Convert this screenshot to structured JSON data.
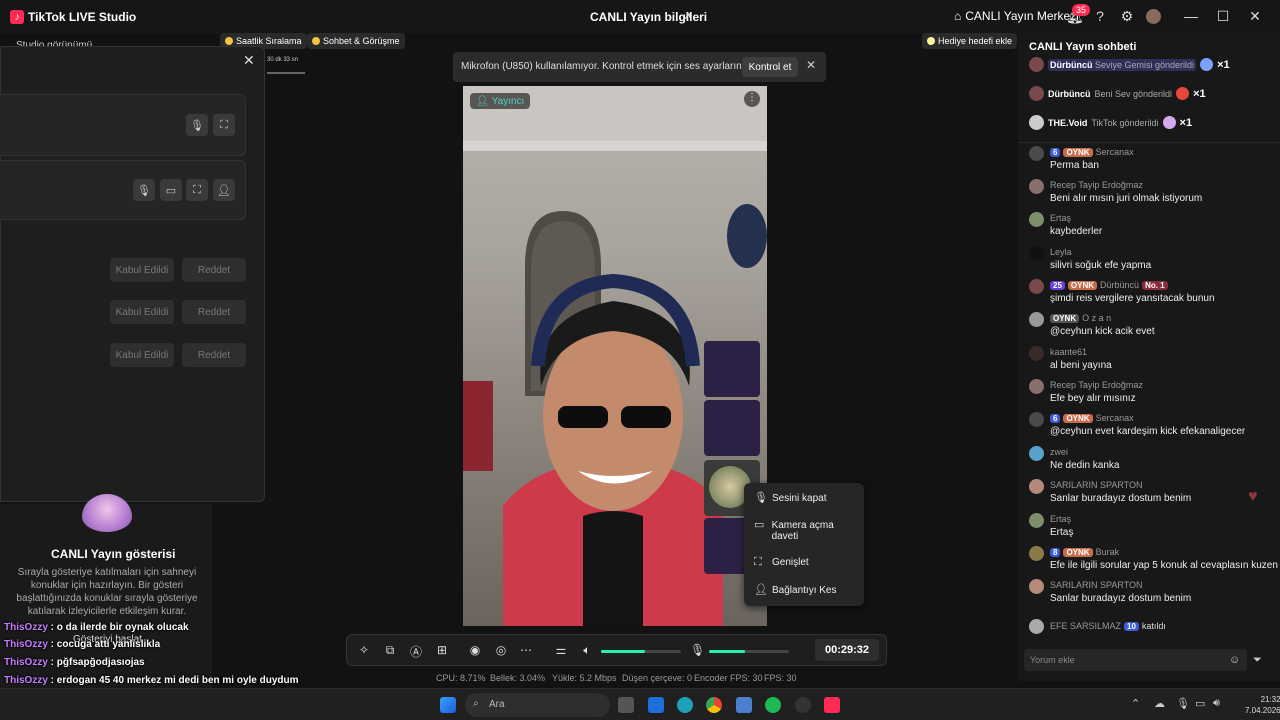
{
  "titlebar": {
    "app_title": "TikTok LIVE Studio",
    "center_title": "CANLI Yayın bilgileri",
    "hub_label": "CANLI Yayın Merkezi",
    "notif_count": "35"
  },
  "pills": {
    "weekly": "Saatlik Sıralama",
    "chat_talk": "Sohbet & Görüşme",
    "gift_goal": "Hediye hedefi ekle",
    "studio_view": "Studio görünümü",
    "countdown": "30 dk 33 sn"
  },
  "guest_panel": {
    "accepted": "Kabul Edildi",
    "reject": "Reddet"
  },
  "showcase": {
    "title": "CANLI Yayın gösterisi",
    "desc": "Sırayla gösteriye katılmaları için sahneyi konuklar için hazırlayın. Bir gösteri başlattığınızda konuklar sırayla gösteriye katılarak izleyicilerle etkileşim kurar.",
    "start": "Gösteriyi başlat"
  },
  "overlay_chat": [
    {
      "name": "ThisOzzy",
      "text": "o da ilerde bir oynak olucak"
    },
    {
      "name": "ThisOzzy",
      "text": "cocuga atti yanlislikla"
    },
    {
      "name": "ThisOzzy",
      "text": "pğfsapğodjasıojas"
    },
    {
      "name": "ThisOzzy",
      "text": "erdogan 45 40 merkez mi dedi ben mi oyle duydum"
    }
  ],
  "banner": {
    "message": "Mikrofon (U850) kullanılamıyor. Kontrol etmek için ses ayarlarını açın.",
    "button": "Kontrol et"
  },
  "video": {
    "host_label": "Yayıncı"
  },
  "context_menu": {
    "mute": "Sesini kapat",
    "camera": "Kamera açma daveti",
    "expand": "Genişlet",
    "disconnect": "Bağlantıyı Kes"
  },
  "controls": {
    "timer": "00:29:32",
    "speaker_level": 0.55,
    "mic_level": 0.45
  },
  "stats": {
    "cpu": "CPU: 8.71%",
    "memory": "Bellek: 3.04%",
    "upload": "Yükle: 5.2 Mbps",
    "dropped": "Düşen çerçeve: 0",
    "encoder": "Encoder FPS: 30",
    "fps": "FPS: 30"
  },
  "chat": {
    "title": "CANLI Yayın sohbeti",
    "gifts": [
      {
        "name": "Dürbüncü",
        "text": "Seviye Gemisi gönderildi",
        "count": "×1"
      },
      {
        "name": "Dürbüncü",
        "text": "Beni Sev gönderildi",
        "count": "×1"
      },
      {
        "name": "THE.Void",
        "text": "TikTok gönderildi",
        "count": "×1"
      }
    ],
    "messages": [
      {
        "level": "6",
        "fan": "OYNK",
        "name": "Sercanax",
        "text": "Perma ban"
      },
      {
        "name": "Recep Tayip Erdoğmaz",
        "text": "Beni alır mısın juri olmak istiyorum"
      },
      {
        "name": "Ertaş",
        "text": "kaybederler"
      },
      {
        "name": "Leyla",
        "text": "silivri soğuk efe yapma"
      },
      {
        "level": "25",
        "fan": "OYNK",
        "name": "Dürbüncü",
        "rank": "No. 1",
        "text": "şimdi reis vergilere yansıtacak bunun"
      },
      {
        "fan": "OYNK",
        "name": "O z a n",
        "text": "@ceyhun kick acik evet"
      },
      {
        "name": "kaante61",
        "text": "al beni yayına"
      },
      {
        "name": "Recep Tayip Erdoğmaz",
        "text": "Efe bey alır mısınız"
      },
      {
        "level": "6",
        "fan": "OYNK",
        "name": "Sercanax",
        "text": "@ceyhun evet kardeşim kick efekanaligecer"
      },
      {
        "name": "zwei",
        "text": "Ne dedin kanka"
      },
      {
        "name": "SARILARIN SPARTON",
        "text": "Sanlar buradayız dostum benim"
      },
      {
        "name": "Ertaş",
        "text": "Ertaş"
      },
      {
        "level": "8",
        "fan": "OYNK",
        "name": "Burak",
        "text": "Efe ile ilgili sorular yap 5 konuk al cevaplasın kuzen"
      },
      {
        "name": "SARILARIN SPARTON",
        "text": "Sanlar buradayız dostum benim"
      }
    ],
    "join": {
      "name": "EFE SARSILMAZ",
      "level": "10",
      "text": "katıldı"
    },
    "input_placeholder": "Yorum ekle"
  },
  "taskbar": {
    "search": "Ara",
    "time": "21:32",
    "date": "7.04.2026"
  }
}
